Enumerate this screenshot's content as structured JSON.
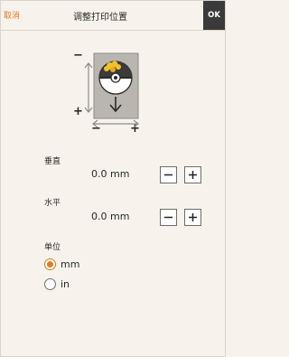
{
  "header": {
    "cancel_label": "取消",
    "title": "调整打印位置",
    "ok_label": "OK"
  },
  "preview": {
    "vertical_minus": "−",
    "vertical_plus": "+",
    "horizontal_minus": "−",
    "horizontal_plus": "+"
  },
  "vertical": {
    "label": "垂直",
    "value": "0.0  mm",
    "minus": "−",
    "plus": "+"
  },
  "horizontal": {
    "label": "水平",
    "value": "0.0  mm",
    "minus": "−",
    "plus": "+"
  },
  "unit": {
    "label": "单位",
    "options": [
      {
        "label": "mm",
        "selected": true
      },
      {
        "label": "in",
        "selected": false
      }
    ]
  },
  "colors": {
    "accent": "#e07c20",
    "background": "#f7f3ec",
    "ok_bg": "#3a3a3a"
  }
}
